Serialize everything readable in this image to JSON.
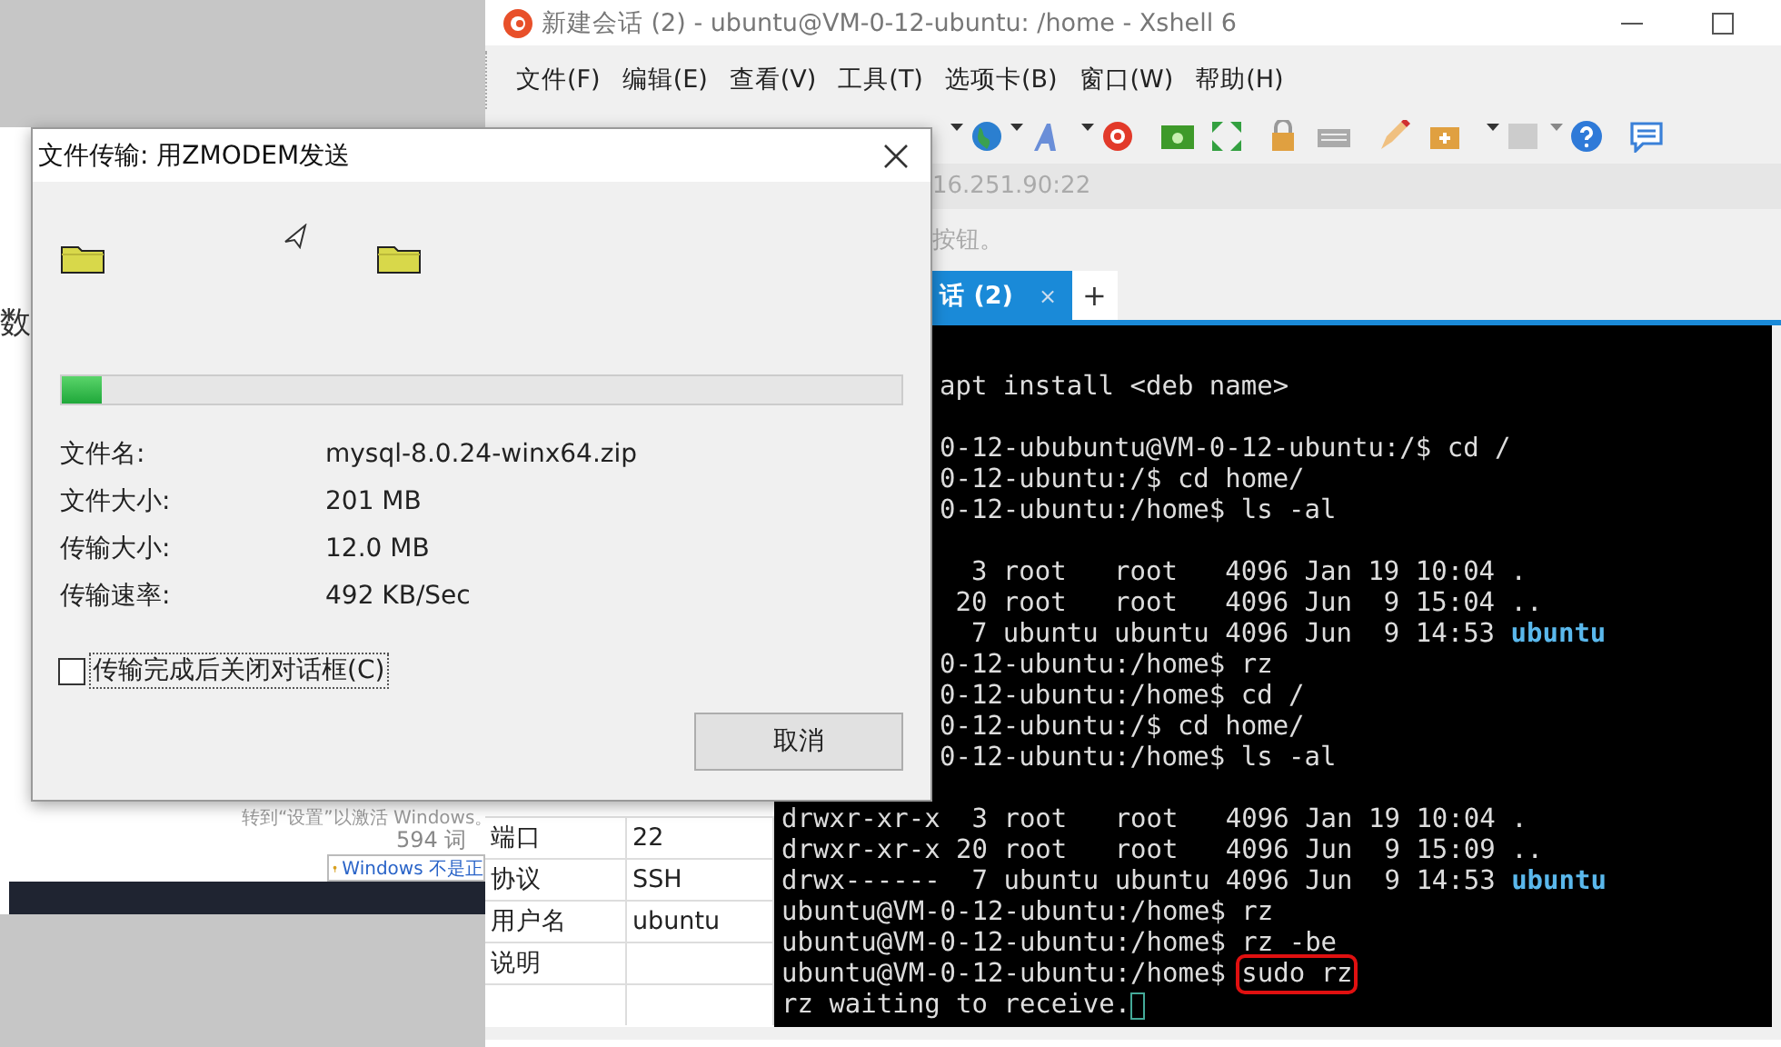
{
  "desktop": {
    "side_text": "数",
    "activation_text": "转到“设置”以激活 Windows。",
    "word_count": "594 词",
    "notification": "Windows 不是正"
  },
  "xshell": {
    "title": "新建会话 (2) - ubuntu@VM-0-12-ubuntu: /home - Xshell 6",
    "menu": [
      "文件(F)",
      "编辑(E)",
      "查看(V)",
      "工具(T)",
      "选项卡(B)",
      "窗口(W)",
      "帮助(H)"
    ],
    "address": "16.251.90:22",
    "hint": "按钮。",
    "tabs": [
      {
        "label": "话 (2)",
        "selected": true,
        "close": "×"
      },
      {
        "label": "+",
        "selected": false
      }
    ],
    "properties": [
      {
        "name": "端口",
        "value": "22"
      },
      {
        "name": "协议",
        "value": "SSH"
      },
      {
        "name": "用户名",
        "value": "ubuntu"
      },
      {
        "name": "说明"
      }
    ],
    "terminal": [
      {
        "kind": "cut",
        "parts": [
          {
            "kind": "plain",
            "text": "apt install <deb name>"
          }
        ]
      },
      {
        "kind": "blank"
      },
      {
        "kind": "cut",
        "parts": [
          {
            "kind": "plain",
            "text": "0-12-ububuntu@VM-0-12-ubuntu:/$ cd /"
          }
        ]
      },
      {
        "kind": "cut",
        "parts": [
          {
            "kind": "plain",
            "text": "0-12-ubuntu:/$ cd home/"
          }
        ]
      },
      {
        "kind": "cut",
        "parts": [
          {
            "kind": "plain",
            "text": "0-12-ubuntu:/home$ ls -al"
          }
        ]
      },
      {
        "kind": "blank"
      },
      {
        "kind": "cut",
        "parts": [
          {
            "kind": "plain",
            "text": "  3 root   root   4096 Jan 19 10:04 ."
          }
        ]
      },
      {
        "kind": "cut",
        "parts": [
          {
            "kind": "plain",
            "text": " 20 root   root   4096 Jun  9 15:04 .."
          }
        ]
      },
      {
        "kind": "cut",
        "parts": [
          {
            "kind": "plain",
            "text": "  7 ubuntu ubuntu 4096 Jun  9 14:53 "
          },
          {
            "kind": "dir",
            "text": "ubuntu"
          }
        ]
      },
      {
        "kind": "cut",
        "parts": [
          {
            "kind": "plain",
            "text": "0-12-ubuntu:/home$ rz"
          }
        ]
      },
      {
        "kind": "cut",
        "parts": [
          {
            "kind": "plain",
            "text": "0-12-ubuntu:/home$ cd /"
          }
        ]
      },
      {
        "kind": "cut",
        "parts": [
          {
            "kind": "plain",
            "text": "0-12-ubuntu:/$ cd home/"
          }
        ]
      },
      {
        "kind": "cut",
        "parts": [
          {
            "kind": "plain",
            "text": "0-12-ubuntu:/home$ ls -al"
          }
        ]
      },
      {
        "kind": "blank"
      },
      {
        "kind": "full",
        "parts": [
          {
            "kind": "plain",
            "text": "drwxr-xr-x  3 root   root   4096 Jan 19 10:04 ."
          }
        ]
      },
      {
        "kind": "full",
        "parts": [
          {
            "kind": "plain",
            "text": "drwxr-xr-x 20 root   root   4096 Jun  9 15:09 .."
          }
        ]
      },
      {
        "kind": "full",
        "parts": [
          {
            "kind": "plain",
            "text": "drwx------  7 ubuntu ubuntu 4096 Jun  9 14:53 "
          },
          {
            "kind": "dir",
            "text": "ubuntu"
          }
        ]
      },
      {
        "kind": "full",
        "parts": [
          {
            "kind": "plain",
            "text": "ubuntu@VM-0-12-ubuntu:/home$ rz"
          }
        ]
      },
      {
        "kind": "full",
        "parts": [
          {
            "kind": "plain",
            "text": "ubuntu@VM-0-12-ubuntu:/home$ rz -be"
          }
        ]
      },
      {
        "kind": "full",
        "parts": [
          {
            "kind": "plain",
            "text": "ubuntu@VM-0-12-ubuntu:/home$ "
          },
          {
            "kind": "boxed",
            "text": "sudo rz"
          }
        ]
      },
      {
        "kind": "full",
        "cursor": true,
        "parts": [
          {
            "kind": "plain",
            "text": "rz waiting to receive."
          }
        ]
      }
    ]
  },
  "dialog": {
    "title": "文件传输: 用ZMODEM发送",
    "progress": {
      "level": 0.047
    },
    "fields": [
      {
        "label": "文件名:",
        "value": "mysql-8.0.24-winx64.zip"
      },
      {
        "label": "文件大小:",
        "value": "201 MB"
      },
      {
        "label": "传输大小:",
        "value": "12.0 MB"
      },
      {
        "label": "传输速率:",
        "value": "492 KB/Sec"
      }
    ],
    "close_when_done": {
      "label": "传输完成后关闭对话框(C)",
      "checked": false
    },
    "cancel_button": "取消"
  }
}
